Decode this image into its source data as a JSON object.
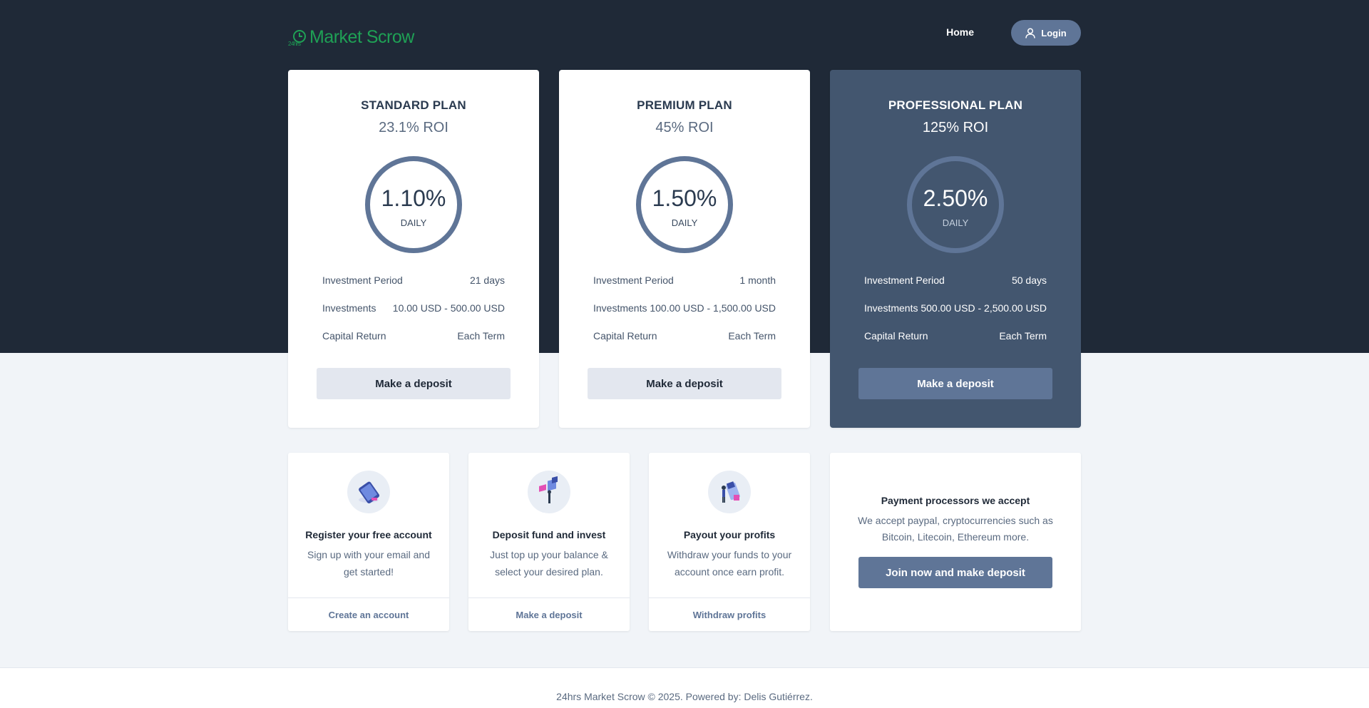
{
  "brand": {
    "logo_text": "Market Scrow",
    "logo_color": "#1fa055"
  },
  "nav": {
    "home_label": "Home",
    "login_label": "Login"
  },
  "colors": {
    "accent": "#5f7597",
    "hero_bg": "#1f2937",
    "highlight_card": "#43566f"
  },
  "plans": [
    {
      "name": "STANDARD PLAN",
      "roi": "23.1% ROI",
      "rate": "1.10%",
      "rate_label": "DAILY",
      "rows": [
        {
          "label": "Investment Period",
          "value": "21 days"
        },
        {
          "label": "Investments",
          "value": "10.00 USD - 500.00 USD"
        },
        {
          "label": "Capital Return",
          "value": "Each Term"
        }
      ],
      "button": "Make a deposit"
    },
    {
      "name": "PREMIUM PLAN",
      "roi": "45% ROI",
      "rate": "1.50%",
      "rate_label": "DAILY",
      "rows": [
        {
          "label": "Investment Period",
          "value": "1 month"
        },
        {
          "label": "Investments",
          "value": "100.00 USD - 1,500.00 USD"
        },
        {
          "label": "Capital Return",
          "value": "Each Term"
        }
      ],
      "button": "Make a deposit"
    },
    {
      "name": "PROFESSIONAL PLAN",
      "roi": "125% ROI",
      "rate": "2.50%",
      "rate_label": "DAILY",
      "rows": [
        {
          "label": "Investment Period",
          "value": "50 days"
        },
        {
          "label": "Investments",
          "value": "500.00 USD - 2,500.00 USD"
        },
        {
          "label": "Capital Return",
          "value": "Each Term"
        }
      ],
      "button": "Make a deposit"
    }
  ],
  "steps": [
    {
      "title": "Register your free account",
      "text": "Sign up with your email and get started!",
      "link": "Create an account",
      "icon": "phone-illustration-icon"
    },
    {
      "title": "Deposit fund and invest",
      "text": "Just top up your balance & select your desired plan.",
      "link": "Make a deposit",
      "icon": "invest-illustration-icon"
    },
    {
      "title": "Payout your profits",
      "text": "Withdraw your funds to your account once earn profit.",
      "link": "Withdraw profits",
      "icon": "payout-illustration-icon"
    }
  ],
  "payment": {
    "title": "Payment processors we accept",
    "text": "We accept paypal, cryptocurrencies such as Bitcoin, Litecoin, Ethereum more.",
    "button": "Join now and make deposit"
  },
  "footer": {
    "text": "24hrs Market Scrow © 2025. Powered by: Delis Gutiérrez."
  }
}
